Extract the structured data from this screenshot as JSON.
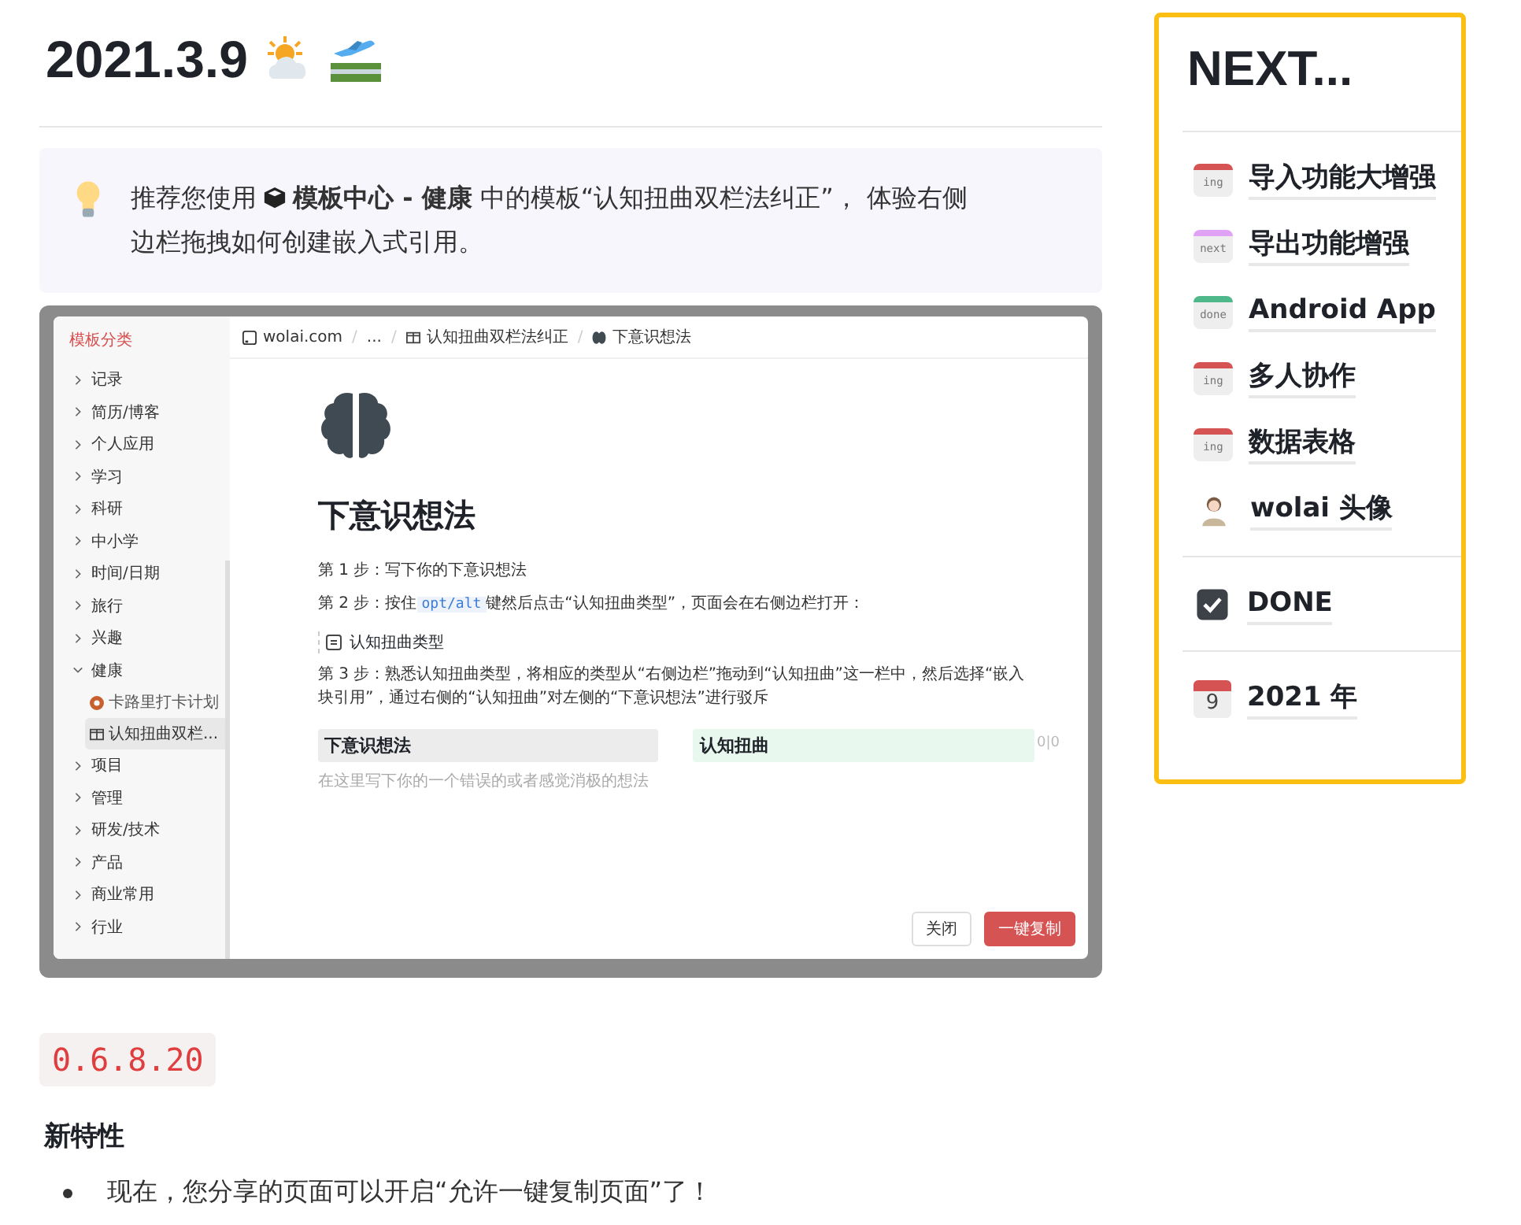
{
  "title": "2021.3.9",
  "callout": {
    "text_before": "推荐您使用",
    "text_after": "**模板中心 - 健康** 中的模板“认知扭曲双栏法纠正”， 体验右侧",
    "text_line2": "边栏拖拽如何创建嵌入式引用。"
  },
  "screenshot": {
    "sidebar": {
      "title": "模板分类",
      "items": [
        {
          "label": "记录",
          "expanded": false
        },
        {
          "label": "简历/博客",
          "expanded": false
        },
        {
          "label": "个人应用",
          "expanded": false
        },
        {
          "label": "学习",
          "expanded": false
        },
        {
          "label": "科研",
          "expanded": false
        },
        {
          "label": "中小学",
          "expanded": false
        },
        {
          "label": "时间/日期",
          "expanded": false
        },
        {
          "label": "旅行",
          "expanded": false
        },
        {
          "label": "兴趣",
          "expanded": false
        },
        {
          "label": "健康",
          "expanded": true,
          "children": [
            {
              "label": "卡路里打卡计划",
              "kind": "donut",
              "selected": false
            },
            {
              "label": "认知扭曲双栏...",
              "kind": "table",
              "selected": true
            }
          ]
        },
        {
          "label": "项目",
          "expanded": false
        },
        {
          "label": "管理",
          "expanded": false
        },
        {
          "label": "研发/技术",
          "expanded": false
        },
        {
          "label": "产品",
          "expanded": false
        },
        {
          "label": "商业常用",
          "expanded": false
        },
        {
          "label": "行业",
          "expanded": false
        }
      ]
    },
    "breadcrumb_separator": "/",
    "breadcrumb": [
      {
        "label": "wolai.com",
        "kind": "site"
      },
      {
        "label": "...",
        "kind": "plain"
      },
      {
        "label": "认知扭曲双栏法纠正",
        "kind": "table"
      },
      {
        "label": "下意识想法",
        "kind": "brain"
      }
    ],
    "page_title": "下意识想法",
    "blocks": [
      {
        "kind": "text",
        "text": "第 1 步：写下你的下意识想法"
      },
      {
        "kind": "code_text",
        "text": "第 2 步：按住",
        "code": "opt/alt",
        "after": "键然后点击“认知扭曲类型”，页面会在右侧边栏打开："
      },
      {
        "kind": "page_link",
        "text": "认知扭曲类型"
      },
      {
        "kind": "text",
        "text": "第 3 步：熟悉认知扭曲类型，将相应的类型从“右侧边栏”拖动到“认知扭曲”这一栏中，然后选择“嵌入块引用”，通过右侧的“认知扭曲”对左侧的“下意识想法”进行驳斥"
      }
    ],
    "columns": [
      {
        "heading": "下意识想法",
        "color": "#ececec",
        "placeholder": "在这里写下你的一个错误的或者感觉消极的想法"
      },
      {
        "heading": "认知扭曲",
        "color": "#e9f8ee"
      }
    ],
    "counter": "0|0",
    "buttons": [
      {
        "label": "关闭",
        "kind": "secondary"
      },
      {
        "label": "一键复制",
        "kind": "primary"
      }
    ]
  },
  "version": "0.6.8.20",
  "section_heading": "新特性",
  "bullets": [
    "现在，您分享的页面可以开启“允许一键复制页面”了！"
  ],
  "panel": {
    "title": "NEXT...",
    "groups": [
      [
        {
          "kind": "status",
          "badge": "ing",
          "color": "#d65353",
          "label": "导入功能大增强"
        },
        {
          "kind": "status",
          "badge": "next",
          "color": "#e0a2f5",
          "label": "导出功能增强"
        },
        {
          "kind": "status",
          "badge": "done",
          "color": "#4fb88a",
          "label": "Android App"
        },
        {
          "kind": "status",
          "badge": "ing",
          "color": "#d65353",
          "label": "多人协作"
        },
        {
          "kind": "status",
          "badge": "ing",
          "color": "#d65353",
          "label": "数据表格"
        },
        {
          "kind": "avatar",
          "label": "wolai 头像"
        }
      ],
      [
        {
          "kind": "checkbox",
          "checked": true,
          "label": "DONE"
        }
      ],
      [
        {
          "kind": "calendar",
          "day": "9",
          "label": "2021 年"
        }
      ]
    ]
  }
}
